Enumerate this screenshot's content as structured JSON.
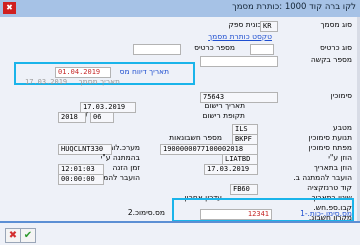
{
  "window": {
    "title": "לקו ברה קוד 1000 :כותרת מסמך"
  },
  "fields": {
    "doc_type": {
      "label": "סוג מסמך",
      "code": "KR",
      "value": "חשבונית ספק"
    },
    "doc_type_text": {
      "value": "טקסט כותרת מסמך"
    },
    "card_type": {
      "label": "סוג כרטיס",
      "secondary_label": "מספר כרטיס"
    },
    "request_number": {
      "label": "מספר בקשה"
    },
    "tax_date": {
      "label": "תאריך דיווח מס",
      "value": "01.04.2019"
    },
    "extra_row": {
      "label": "תאריך מסמך",
      "value": "17.03.2019"
    },
    "reference": {
      "label": "סימוכין",
      "value": "75643"
    },
    "entry_date": {
      "label": "תאריך רישום",
      "value": "17.03.2019"
    },
    "posting_period": {
      "label": "תקופת רישום",
      "year": "2018",
      "period": "06"
    },
    "currency": {
      "label": "מטבע",
      "value": "ILS"
    },
    "transaction_type": {
      "label": "תנועת סימוכין",
      "value": "BKPF",
      "secondary_label": "מספר חשבונאות"
    },
    "reference_key": {
      "label": "מפתח סימוכין",
      "value": "1900000077100002018",
      "secondary_label": "מערכ.לוגית",
      "secondary_value": "HUQCLNT330"
    },
    "entered_by": {
      "label": "הוזן ע\"י",
      "value": "LIATBD",
      "secondary_label": "בהמתנה ע\"י"
    },
    "entry_date2": {
      "label": "הוזן בתאריך",
      "value": "17.03.2019",
      "secondary_label": "זמן הזנה",
      "secondary_value": "12:01:03"
    },
    "parked_date": {
      "label": "הועבר להמתנה ב.",
      "secondary_label": "הועבר להמתנה ב.",
      "secondary_value": "00:00:00"
    },
    "transaction_code": {
      "label": "קוד טרנזקציה",
      "value": "FB60"
    },
    "changed": {
      "label": "שינוי בתאריך",
      "secondary_label": "עדכון אחרון"
    },
    "ledger": {
      "label": "קבו.ספ.חש."
    },
    "receipt_source": {
      "label": "מקרון חשבונ."
    },
    "tax_code1": {
      "label": "מס.סימו.-כות.-1",
      "value": "12341"
    },
    "tax_code2": {
      "label": "מס.סימוכ.2"
    }
  },
  "buttons": {
    "cancel": "✖",
    "confirm": "✔"
  }
}
